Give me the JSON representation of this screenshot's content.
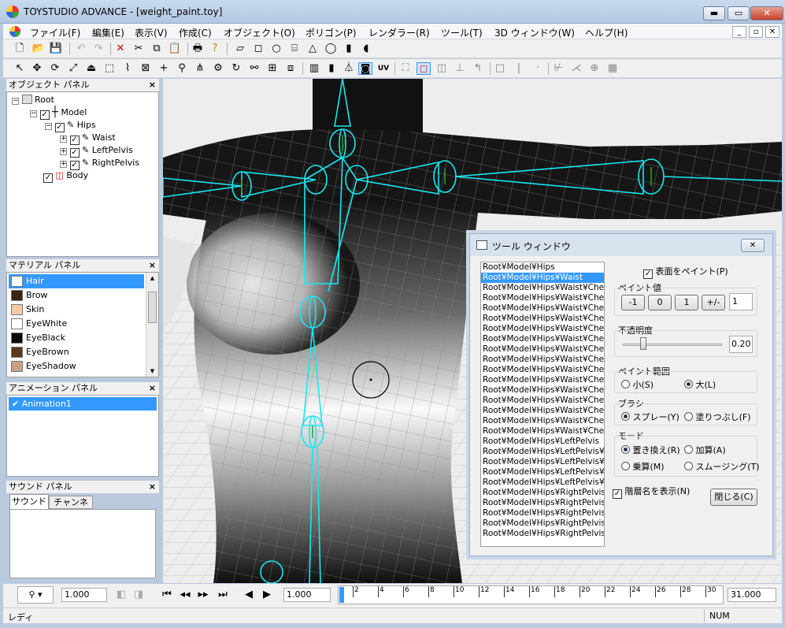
{
  "window": {
    "title": "TOYSTUDIO ADVANCE - [weight_paint.toy]",
    "minimize": "▬",
    "maximize": "▭",
    "close": "✕"
  },
  "menu": [
    "ファイル(F)",
    "編集(E)",
    "表示(V)",
    "作成(C)",
    "オブジェクト(O)",
    "ポリゴン(P)",
    "レンダラー(R)",
    "ツール(T)",
    "3D ウィンドウ(W)",
    "ヘルプ(H)"
  ],
  "mdi": {
    "minimize": "_",
    "restore": "▫",
    "close": "✕"
  },
  "toolbar": {
    "uv_label": "UV"
  },
  "object_panel": {
    "title": "オブジェクト パネル",
    "close": "×",
    "tree": [
      {
        "label": "Root",
        "icon": "root-icon"
      },
      {
        "label": "Model",
        "icon": "cross-icon"
      },
      {
        "label": "Hips",
        "icon": "bone-icon"
      },
      {
        "label": "Waist",
        "icon": "bone-icon"
      },
      {
        "label": "LeftPelvis",
        "icon": "bone-icon"
      },
      {
        "label": "RightPelvis",
        "icon": "bone-icon"
      },
      {
        "label": "Body",
        "icon": "mesh-icon"
      }
    ]
  },
  "material_panel": {
    "title": "マテリアル パネル",
    "close": "×",
    "items": [
      {
        "name": "Hair",
        "color": "#ffffff",
        "selected": true
      },
      {
        "name": "Brow",
        "color": "#3a2412"
      },
      {
        "name": "Skin",
        "color": "#f7c9a9"
      },
      {
        "name": "EyeWhite",
        "color": "#ffffff"
      },
      {
        "name": "EyeBlack",
        "color": "#0a0a0a"
      },
      {
        "name": "EyeBrown",
        "color": "#5a3a1a"
      },
      {
        "name": "EyeShadow",
        "color": "#c8a088"
      }
    ]
  },
  "animation_panel": {
    "title": "アニメーション パネル",
    "close": "×",
    "items": [
      "Animation1"
    ]
  },
  "sound_panel": {
    "title": "サウンド パネル",
    "close": "×",
    "tabs": [
      "サウンド",
      "チャンネル"
    ]
  },
  "tool_window": {
    "title": "ツール ウィンドウ",
    "close": "✕",
    "list": [
      "Root¥Model¥Hips",
      "Root¥Model¥Hips¥Waist",
      "Root¥Model¥Hips¥Waist¥Chest",
      "Root¥Model¥Hips¥Waist¥Chest¥",
      "Root¥Model¥Hips¥Waist¥Chest¥",
      "Root¥Model¥Hips¥Waist¥Chest¥",
      "Root¥Model¥Hips¥Waist¥Chest¥",
      "Root¥Model¥Hips¥Waist¥Chest¥",
      "Root¥Model¥Hips¥Waist¥Chest¥",
      "Root¥Model¥Hips¥Waist¥Chest¥",
      "Root¥Model¥Hips¥Waist¥Chest¥",
      "Root¥Model¥Hips¥Waist¥Chest¥",
      "Root¥Model¥Hips¥Waist¥Chest¥",
      "Root¥Model¥Hips¥Waist¥Chest¥",
      "Root¥Model¥Hips¥Waist¥Chest¥",
      "Root¥Model¥Hips¥Waist¥Chest¥",
      "Root¥Model¥Hips¥Waist¥Chest¥",
      "Root¥Model¥Hips¥LeftPelvis",
      "Root¥Model¥Hips¥LeftPelvis¥Le",
      "Root¥Model¥Hips¥LeftPelvis¥Le",
      "Root¥Model¥Hips¥LeftPelvis¥Le",
      "Root¥Model¥Hips¥LeftPelvis¥Le",
      "Root¥Model¥Hips¥RightPelvis",
      "Root¥Model¥Hips¥RightPelvis¥R",
      "Root¥Model¥Hips¥RightPelvis¥R",
      "Root¥Model¥Hips¥RightPelvis¥R",
      "Root¥Model¥Hips¥RightPelvis¥R"
    ],
    "selected_index": 1,
    "paint_surface": "表面をペイント(P)",
    "paint_value_label": "ペイント値",
    "pv_buttons": [
      "-1",
      "0",
      "1",
      "+/-"
    ],
    "pv_value": "1",
    "opacity_label": "不透明度",
    "opacity_value": "0.20",
    "opacity_fraction": 0.2,
    "range_label": "ペイント範囲",
    "range_small": "小(S)",
    "range_large": "大(L)",
    "brush_label": "ブラシ",
    "brush_spray": "スプレー(Y)",
    "brush_fill": "塗りつぶし(F)",
    "mode_label": "モード",
    "mode_replace": "置き換え(R)",
    "mode_add": "加算(A)",
    "mode_mul": "乗算(M)",
    "mode_smooth": "スムージング(T)",
    "show_names": "階層名を表示(N)",
    "close_button": "閉じる(C)"
  },
  "playbar": {
    "speed": "1.000",
    "frame": "1.000",
    "end_frame": "31.000",
    "ticks": [
      "2",
      "4",
      "6",
      "8",
      "10",
      "12",
      "14",
      "16",
      "18",
      "20",
      "22",
      "24",
      "26",
      "28",
      "30"
    ]
  },
  "status": {
    "text": "レディ",
    "num": "NUM"
  }
}
